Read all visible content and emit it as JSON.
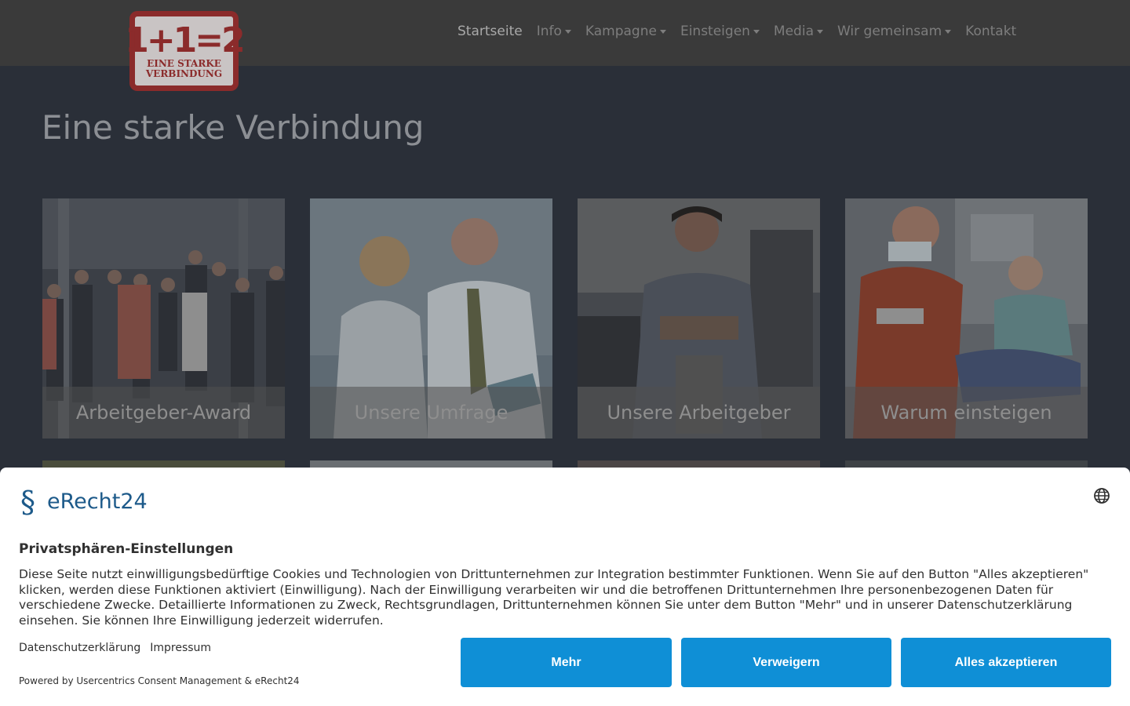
{
  "nav": {
    "items": [
      {
        "label": "Startseite",
        "dropdown": false,
        "active": true
      },
      {
        "label": "Info",
        "dropdown": true
      },
      {
        "label": "Kampagne",
        "dropdown": true
      },
      {
        "label": "Einsteigen",
        "dropdown": true
      },
      {
        "label": "Media",
        "dropdown": true
      },
      {
        "label": "Wir gemeinsam",
        "dropdown": true
      },
      {
        "label": "Kontakt",
        "dropdown": false
      }
    ]
  },
  "logo": {
    "number": "1+1=2",
    "line1": "EINE STARKE",
    "line2": "VERBINDUNG"
  },
  "page": {
    "title": "Eine starke Verbindung"
  },
  "cards": [
    {
      "caption": "Arbeitgeber-Award"
    },
    {
      "caption": "Unsere Umfrage"
    },
    {
      "caption": "Unsere Arbeitgeber"
    },
    {
      "caption": "Warum einsteigen"
    }
  ],
  "consent": {
    "brand": "eRecht24",
    "title": "Privatsphären-Einstellungen",
    "description": "Diese Seite nutzt einwilligungsbedürftige Cookies und Technologien von Drittunternehmen zur Integration bestimmter Funktionen. Wenn Sie auf den Button \"Alles akzeptieren\" klicken, werden diese Funktionen aktiviert (Einwilligung). Nach der Einwilligung verarbeiten wir und die betroffenen Drittunternehmen Ihre personenbezogenen Daten für verschiedene Zwecke. Detaillierte Informationen zu Zweck, Rechtsgrundlagen, Drittunternehmen können Sie unter dem Button \"Mehr\" und in unserer Datenschutzerklärung einsehen. Sie können Ihre Einwilligung jederzeit widerrufen.",
    "link_privacy": "Datenschutzerklärung",
    "link_imprint": "Impressum",
    "powered": "Powered by Usercentrics Consent Management & eRecht24",
    "btn_more": "Mehr",
    "btn_deny": "Verweigern",
    "btn_accept": "Alles akzeptieren"
  },
  "colors": {
    "accent": "#0f8fd6",
    "brand": "#1d5a8a",
    "logo": "#8b2b2b"
  }
}
